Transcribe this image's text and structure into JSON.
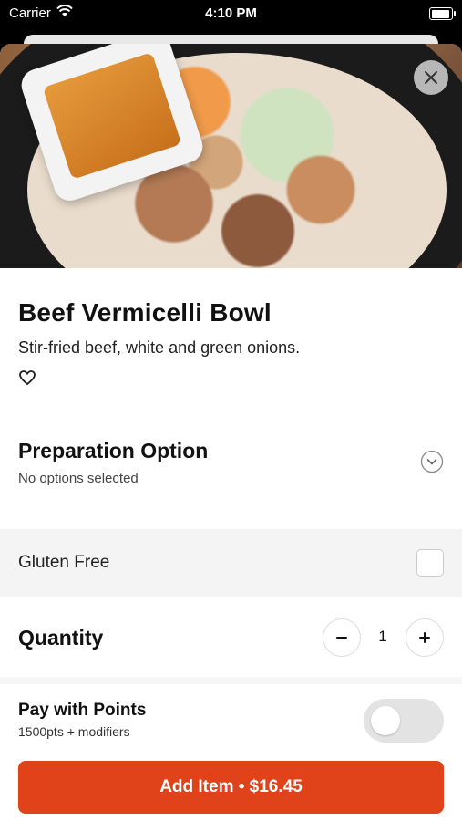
{
  "status_bar": {
    "carrier": "Carrier",
    "time": "4:10 PM"
  },
  "item": {
    "title": "Beef Vermicelli Bowl",
    "description": "Stir-fried beef, white and green onions."
  },
  "preparation": {
    "heading": "Preparation Option",
    "status": "No options selected"
  },
  "gluten_free": {
    "label": "Gluten Free",
    "checked": false
  },
  "quantity": {
    "label": "Quantity",
    "value": "1"
  },
  "points": {
    "label": "Pay with Points",
    "detail": "1500pts + modifiers",
    "enabled": false
  },
  "cta": {
    "label": "Add Item • $16.45"
  },
  "colors": {
    "accent": "#e0421a"
  },
  "icons": [
    "wifi-icon",
    "battery-icon",
    "close-icon",
    "heart-icon",
    "chevron-down-icon",
    "minus-icon",
    "plus-icon"
  ]
}
